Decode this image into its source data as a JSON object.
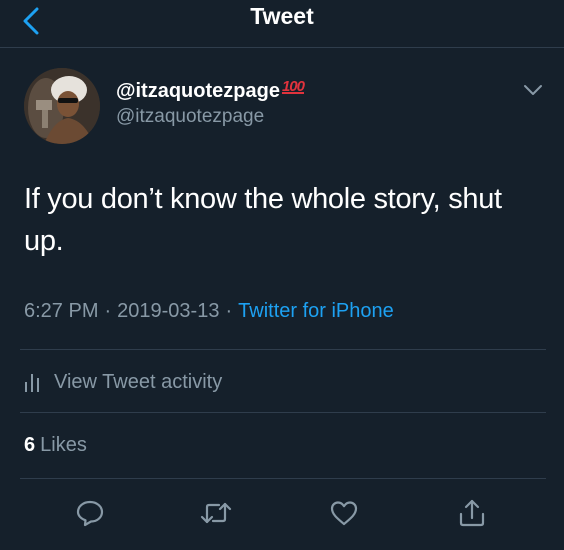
{
  "header": {
    "title": "Tweet",
    "back_icon": "chevron-left-icon",
    "back_color": "#1da1f2"
  },
  "author": {
    "display_name": "@itzaquotezpage",
    "badge": "100",
    "handle": "@itzaquotezpage"
  },
  "tweet": {
    "text": "If you don’t know the whole story, shut up."
  },
  "meta": {
    "time": "6:27 PM",
    "date": "2019-03-13",
    "separator": "·",
    "source": "Twitter for iPhone"
  },
  "activity": {
    "label": "View Tweet activity",
    "icon": "bar-chart-icon"
  },
  "likes": {
    "count": "6",
    "label": "Likes"
  },
  "actions": [
    {
      "name": "reply",
      "icon": "comment-icon"
    },
    {
      "name": "retweet",
      "icon": "retweet-icon"
    },
    {
      "name": "like",
      "icon": "heart-icon"
    },
    {
      "name": "share",
      "icon": "share-icon"
    }
  ],
  "colors": {
    "background": "#15202b",
    "accent": "#1da1f2",
    "secondary_text": "#8899a6",
    "divider": "#2f3d4c",
    "badge": "#e0333d"
  }
}
